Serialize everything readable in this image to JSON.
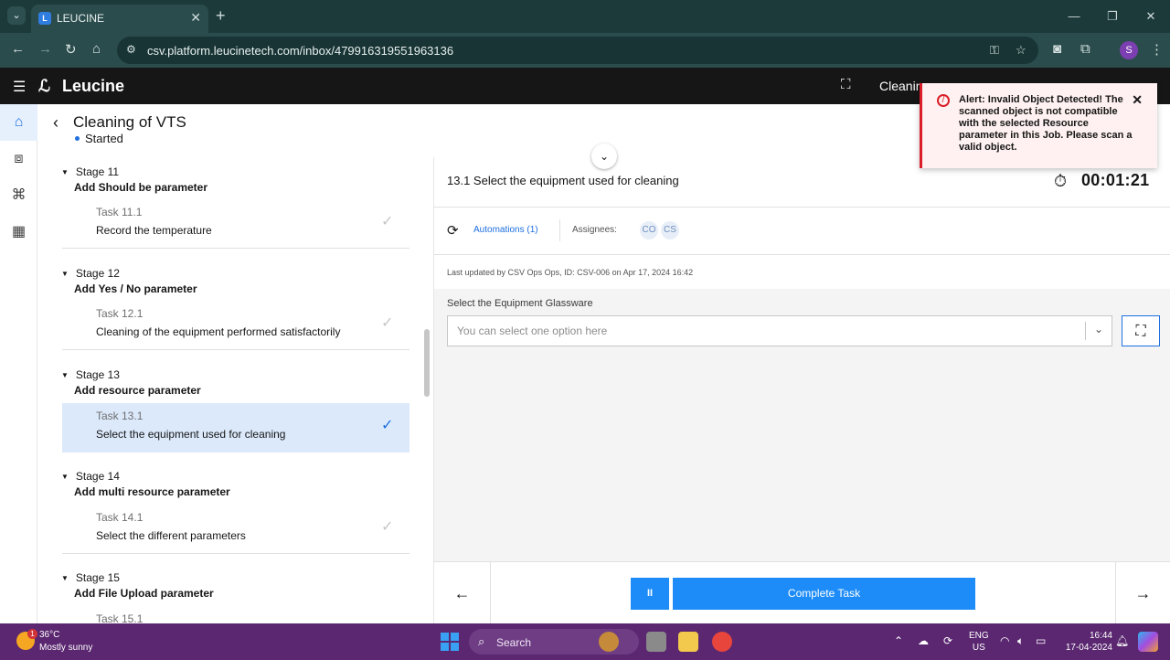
{
  "browser": {
    "tab_title": "LEUCINE",
    "url": "csv.platform.leucinetech.com/inbox/479916319551963136",
    "profile_initial": "S"
  },
  "app": {
    "logo_text": "Leucine",
    "header_text": "Cleanin"
  },
  "job": {
    "title": "Cleaning of VTS",
    "status": "Started"
  },
  "stages": [
    {
      "stage_label": "Stage 11",
      "stage_name": "Add Should be parameter",
      "task_id": "Task 11.1",
      "task_name": "Record the temperature",
      "active": false
    },
    {
      "stage_label": "Stage 12",
      "stage_name": "Add Yes / No parameter",
      "task_id": "Task 12.1",
      "task_name": "Cleaning of the equipment performed satisfactorily",
      "active": false
    },
    {
      "stage_label": "Stage 13",
      "stage_name": "Add resource parameter",
      "task_id": "Task 13.1",
      "task_name": "Select the equipment used for cleaning",
      "active": true
    },
    {
      "stage_label": "Stage 14",
      "stage_name": "Add multi resource parameter",
      "task_id": "Task 14.1",
      "task_name": "Select the different parameters",
      "active": false
    },
    {
      "stage_label": "Stage 15",
      "stage_name": "Add File Upload parameter",
      "task_id": "Task 15.1",
      "task_name": "",
      "active": false
    }
  ],
  "task": {
    "title": "13.1 Select the equipment used for cleaning",
    "timer": "00:01:21",
    "automations_label": "Automations (1)",
    "assignees_label": "Assignees:",
    "assignees": [
      "CO",
      "CS"
    ],
    "last_updated": "Last updated by CSV Ops Ops, ID: CSV-006 on Apr 17, 2024 16:42",
    "field_label": "Select the Equipment Glassware",
    "field_placeholder": "You can select one option here",
    "pause_label": "II",
    "complete_label": "Complete Task"
  },
  "alert": {
    "message": "Alert: Invalid Object Detected! The scanned object is not compatible with the selected Resource parameter in this Job. Please scan a valid object.",
    "close": "✕"
  },
  "taskbar": {
    "temp": "36°C",
    "weather": "Mostly sunny",
    "weather_badge": "1",
    "search_label": "Search",
    "lang_line1": "ENG",
    "lang_line2": "US",
    "time": "16:44",
    "date": "17-04-2024"
  },
  "colors": {
    "accent": "#1d6fe0",
    "button": "#1d8cf8",
    "alert_red": "#da1e28",
    "browser_chrome": "#2b4c4c",
    "taskbar": "#5a2770"
  }
}
